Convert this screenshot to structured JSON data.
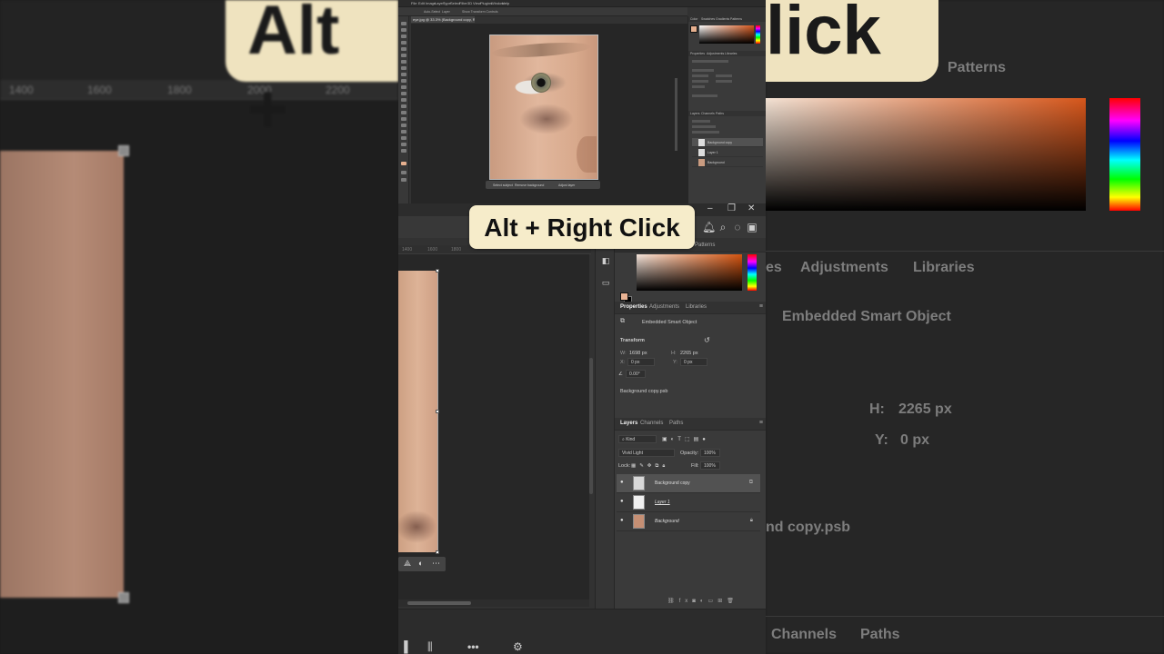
{
  "caption": {
    "text": "Alt + Right Click"
  },
  "background_banner": {
    "left_text": "Alt +",
    "right_text": "lick"
  },
  "background_ruler": [
    "1400",
    "1600",
    "1800",
    "2000",
    "2200"
  ],
  "background_right": {
    "patterns_tab": "Patterns",
    "tabs": [
      "es",
      "Adjustments",
      "Libraries"
    ],
    "smart_object": "Embedded Smart Object",
    "height_label": "H:",
    "height_value": "2265 px",
    "y_label": "Y:",
    "y_value": "0 px",
    "file_label": "nd copy.psb",
    "bottom_tabs": [
      "Channels",
      "Paths"
    ]
  },
  "top_screenshot": {
    "menu": [
      "File",
      "Edit",
      "Image",
      "Layer",
      "Type",
      "Select",
      "Filter",
      "3D",
      "View",
      "Plugins",
      "Window",
      "Help"
    ],
    "options": [
      "Auto-Select",
      "Layer",
      "Show Transform Controls"
    ],
    "doc_tab": "eye.jpg @ 33.3% (Background copy, RGB/8)",
    "context_bar": [
      "Select subject",
      "Remove background",
      "Adjust layer"
    ],
    "panel_tabs_color": [
      "Color",
      "Swatches",
      "Gradients",
      "Patterns"
    ],
    "panel_tabs_props": [
      "Properties",
      "Adjustments",
      "Libraries"
    ],
    "panel_tabs_layers": [
      "Layers",
      "Channels",
      "Paths"
    ],
    "layers": [
      "Background copy",
      "Layer 1",
      "Background"
    ]
  },
  "panel": {
    "color_tabs": [
      "Patterns"
    ],
    "props_tabs": [
      "Properties",
      "Adjustments",
      "Libraries"
    ],
    "smart_object": "Embedded Smart Object",
    "transform_heading": "Transform",
    "w_label": "W:",
    "w_value": "1698 px",
    "h_label": "H:",
    "h_value": "2265 px",
    "x_label": "X:",
    "x_value": "0 px",
    "y_label": "Y:",
    "y_value": "0 px",
    "angle_value": "0.00°",
    "file_name": "Background copy.psb",
    "layer_tabs": [
      "Layers",
      "Channels",
      "Paths"
    ],
    "kind_label": "Kind",
    "blend_mode": "Vivid Light",
    "opacity_label": "Opacity:",
    "opacity_value": "100%",
    "lock_label": "Lock:",
    "fill_label": "Fill:",
    "fill_value": "100%",
    "layers": [
      {
        "name": "Background copy",
        "selected": true
      },
      {
        "name": "Layer 1",
        "selected": false
      },
      {
        "name": "Background",
        "selected": false
      }
    ]
  },
  "ruler_bottom": [
    "1400",
    "1600",
    "1800"
  ],
  "colors": {
    "caption_bg": "#f6ecca",
    "foreground": "#e9b394",
    "background_swatch": "#000000",
    "accent_orange": "#d5540f"
  }
}
